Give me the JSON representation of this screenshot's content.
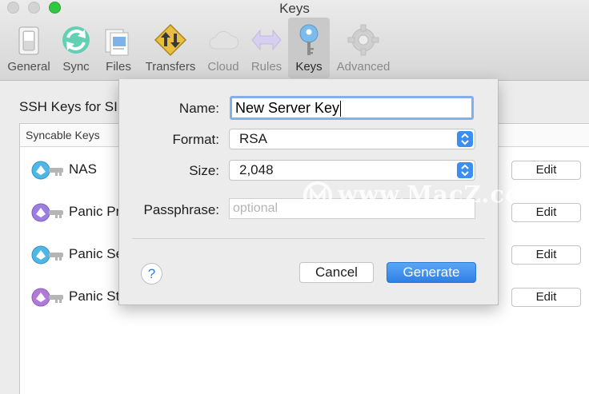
{
  "window": {
    "title": "Keys"
  },
  "toolbar": {
    "items": [
      {
        "label": "General",
        "icon": "general-switch-icon"
      },
      {
        "label": "Sync",
        "icon": "sync-arrows-icon"
      },
      {
        "label": "Files",
        "icon": "files-icon"
      },
      {
        "label": "Transfers",
        "icon": "transfers-icon"
      },
      {
        "label": "Cloud",
        "icon": "cloud-icon"
      },
      {
        "label": "Rules",
        "icon": "rules-icon"
      },
      {
        "label": "Keys",
        "icon": "key-icon"
      },
      {
        "label": "Advanced",
        "icon": "advanced-gear-icon"
      }
    ],
    "active": "Keys"
  },
  "pane": {
    "heading": "SSH Keys for SI",
    "table": {
      "header": "Syncable Keys",
      "rows": [
        {
          "name": "NAS",
          "action": "Edit",
          "key_color": "#4fb7e6"
        },
        {
          "name": "Panic Pr",
          "action": "Edit",
          "key_color": "#9b7fe0"
        },
        {
          "name": "Panic Se",
          "action": "Edit",
          "key_color": "#4fb7e6"
        },
        {
          "name": "Panic St",
          "action": "Edit",
          "key_color": "#b07ad8"
        }
      ]
    }
  },
  "sheet": {
    "name_label": "Name:",
    "name_value": "New Server Key",
    "format_label": "Format:",
    "format_value": "RSA",
    "size_label": "Size:",
    "size_value": "2,048",
    "passphrase_label": "Passphrase:",
    "passphrase_placeholder": "optional",
    "help_label": "?",
    "cancel_label": "Cancel",
    "generate_label": "Generate"
  },
  "watermark": {
    "text": "www.MacZ.com"
  },
  "colors": {
    "accent": "#2f80e6",
    "focus_ring": "#7fb1ea",
    "zoom_button": "#2fc840"
  }
}
